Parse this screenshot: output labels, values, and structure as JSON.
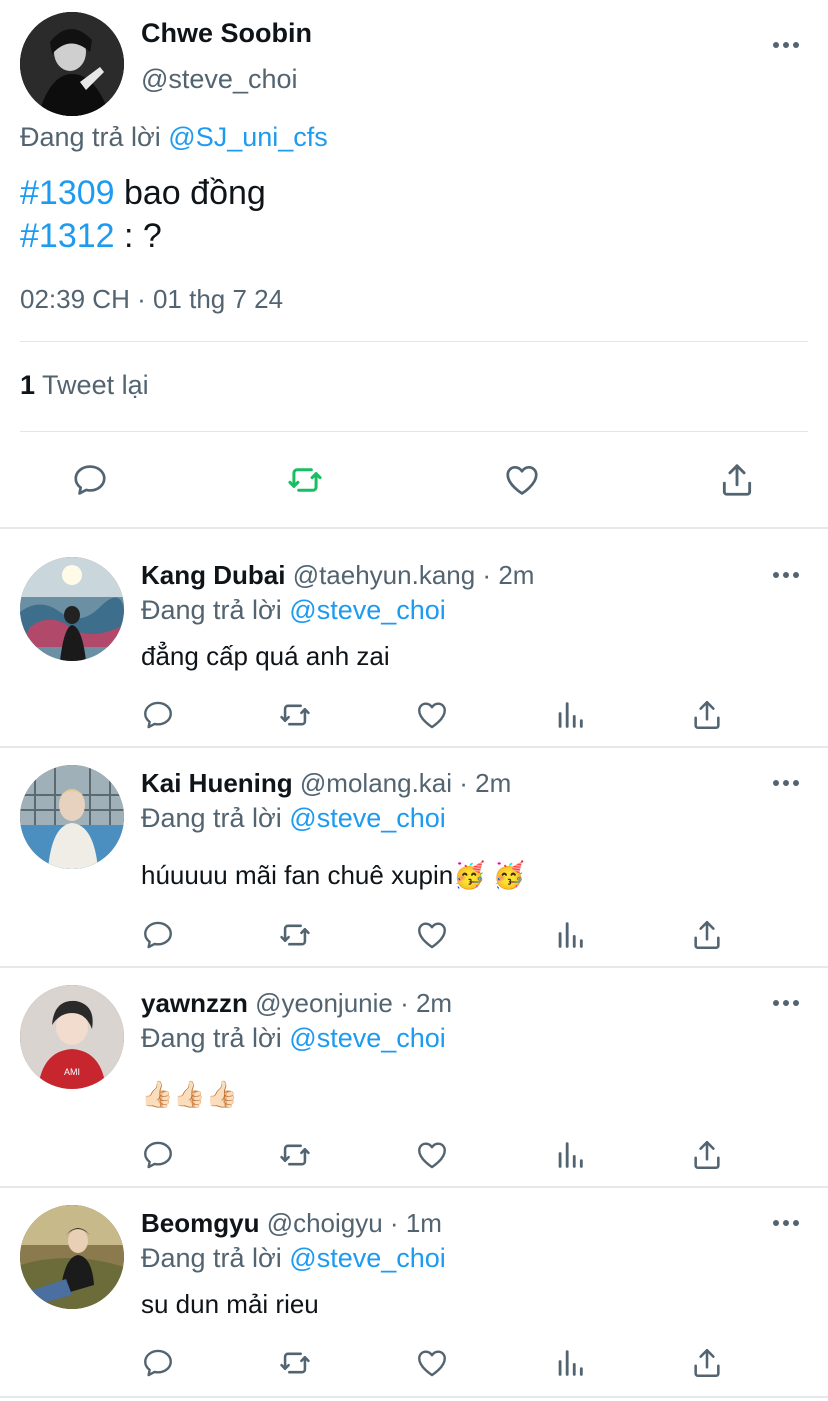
{
  "main_tweet": {
    "display_name": "Chwe Soobin",
    "handle": "@steve_choi",
    "replying_prefix": "Đang trả lời",
    "replying_to": "@SJ_uni_cfs",
    "lines": [
      {
        "tag": "#1309",
        "text": " bao đồng"
      },
      {
        "tag": "#1312",
        "text": " : ?"
      }
    ],
    "timestamp": "02:39 CH · 01 thg 7 24",
    "retweet_count": "1",
    "retweet_label": "Tweet lại",
    "colors": {
      "retweet_active": "#17bf63",
      "link": "#1d9bf0",
      "muted": "#536471"
    }
  },
  "replies": [
    {
      "display_name": "Kang Dubai",
      "meta": "@taehyun.kang · 2m",
      "replying_prefix": "Đang trả lời",
      "replying_to": "@steve_choi",
      "text": "đẳng cấp quá anh zai"
    },
    {
      "display_name": "Kai Huening",
      "meta": "@molang.kai · 2m",
      "replying_prefix": "Đang trả lời",
      "replying_to": "@steve_choi",
      "text": "húuuuu mãi fan chuê xupin🥳 🥳"
    },
    {
      "display_name": "yawnzzn",
      "meta": "@yeonjunie · 2m",
      "replying_prefix": "Đang trả lời",
      "replying_to": "@steve_choi",
      "text": "👍🏻👍🏻👍🏻"
    },
    {
      "display_name": "Beomgyu",
      "meta": "@choigyu · 1m",
      "replying_prefix": "Đang trả lời",
      "replying_to": "@steve_choi",
      "text": "su dun mải rieu"
    }
  ],
  "icons": [
    "reply-icon",
    "retweet-icon",
    "like-icon",
    "views-icon",
    "share-icon",
    "more-icon"
  ]
}
